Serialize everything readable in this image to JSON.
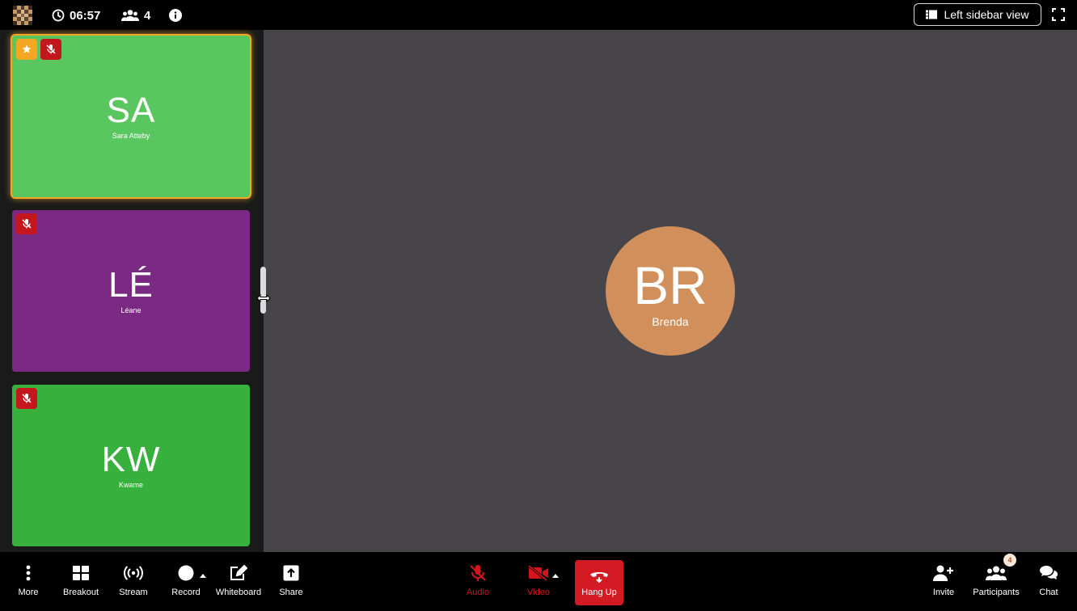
{
  "topbar": {
    "timer": "06:57",
    "participant_count": "4",
    "layout_button_label": "Left sidebar view",
    "icons": [
      "app-logo-icon",
      "clock-icon",
      "users-icon",
      "info-icon",
      "sidebar-layout-icon",
      "fullscreen-icon"
    ]
  },
  "sidebar": {
    "tiles": [
      {
        "initials": "SA",
        "name": "Sara Atteby",
        "color": "#5ac660",
        "pinned": true,
        "muted": true,
        "active": true
      },
      {
        "initials": "LÉ",
        "name": "Léane",
        "color": "#7b2a84",
        "pinned": false,
        "muted": true,
        "active": false
      },
      {
        "initials": "KW",
        "name": "Kwame",
        "color": "#37b03d",
        "pinned": false,
        "muted": true,
        "active": false
      }
    ]
  },
  "stage": {
    "speaker_initials": "BR",
    "speaker_name": "Brenda",
    "background_color": "#474549",
    "avatar_color": "#d08f5b"
  },
  "toolbar": {
    "more_label": "More",
    "breakout_label": "Breakout",
    "stream_label": "Stream",
    "record_label": "Record",
    "whiteboard_label": "Whiteboard",
    "share_label": "Share",
    "audio_label": "Audio",
    "video_label": "Video",
    "hangup_label": "Hang Up",
    "invite_label": "Invite",
    "participants_label": "Participants",
    "participants_badge": "4",
    "chat_label": "Chat"
  },
  "colors": {
    "accent_active": "#f5a623",
    "mute_red": "#c4171d",
    "hangup_red": "#d31a23"
  }
}
